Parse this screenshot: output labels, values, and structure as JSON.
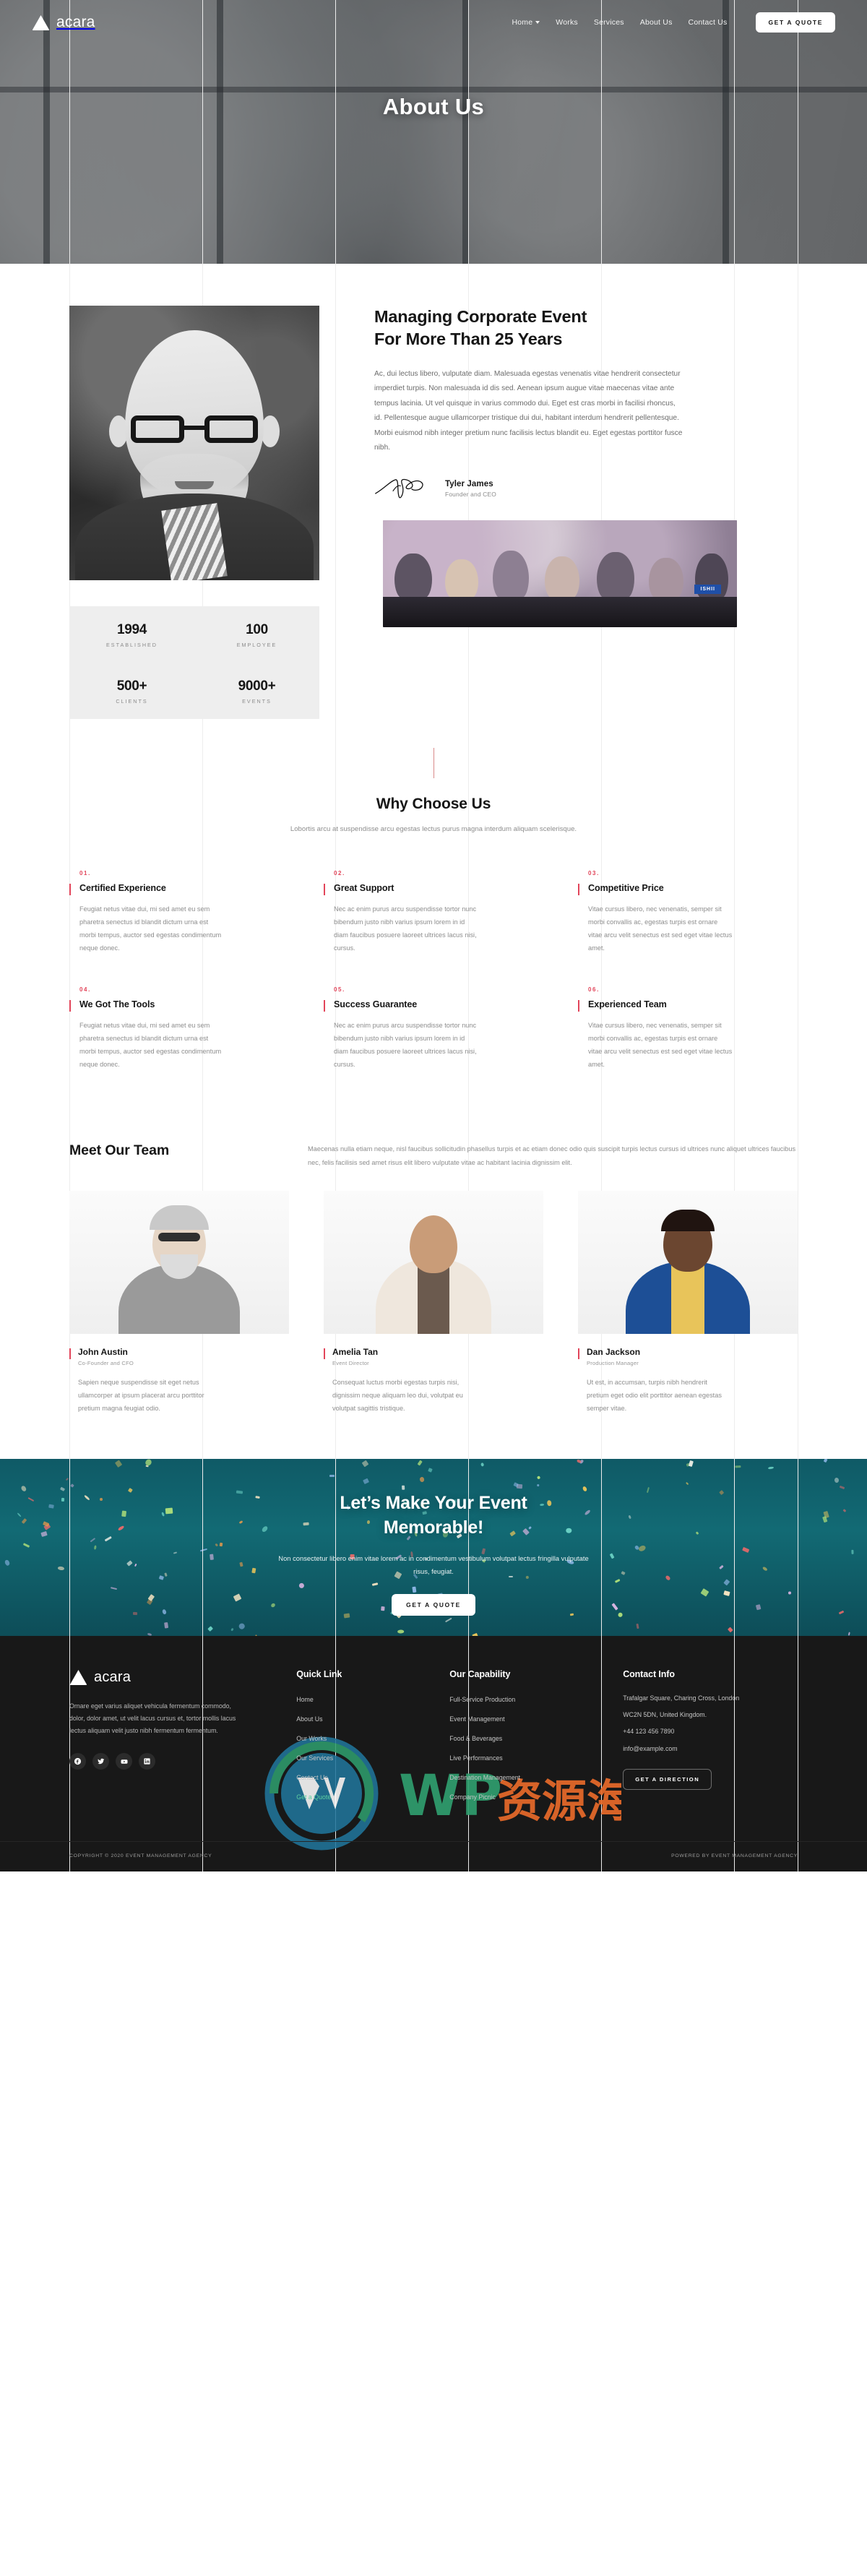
{
  "brand": {
    "name": "acara",
    "logo_icon": "triangle-logo-icon"
  },
  "nav": {
    "items": [
      {
        "label": "Home",
        "has_dropdown": true
      },
      {
        "label": "Works",
        "has_dropdown": false
      },
      {
        "label": "Services",
        "has_dropdown": false
      },
      {
        "label": "About Us",
        "has_dropdown": false
      },
      {
        "label": "Contact Us",
        "has_dropdown": false
      }
    ],
    "cta_label": "GET A QUOTE"
  },
  "hero": {
    "title": "About Us"
  },
  "about": {
    "heading_line1": "Managing Corporate Event",
    "heading_line2": "For More Than 25 Years",
    "body": "Ac, dui lectus libero, vulputate diam. Malesuada egestas venenatis vitae hendrerit consectetur imperdiet turpis. Non malesuada id dis sed. Aenean ipsum augue vitae maecenas vitae ante tempus lacinia. Ut vel quisque in varius commodo dui. Eget est cras morbi in facilisi rhoncus, id. Pellentesque augue ullamcorper tristique dui dui, habitant interdum hendrerit pellentesque. Morbi euismod nibh integer pretium nunc facilisis lectus blandit eu. Eget egestas porttitor fusce nibh.",
    "signature_icon": "signature-icon",
    "person_name": "Tyler James",
    "person_role": "Founder and CEO",
    "meeting_badge": "ISHII"
  },
  "stats": [
    {
      "value": "1994",
      "label": "ESTABLISHED"
    },
    {
      "value": "100",
      "label": "EMPLOYEE"
    },
    {
      "value": "500+",
      "label": "CLIENTS"
    },
    {
      "value": "9000+",
      "label": "EVENTS"
    }
  ],
  "why": {
    "title": "Why Choose Us",
    "subtitle": "Lobortis arcu at suspendisse arcu egestas lectus purus magna interdum aliquam scelerisque.",
    "features": [
      {
        "num": "01.",
        "title": "Certified Experience",
        "body": "Feugiat netus vitae dui, mi sed amet eu sem pharetra senectus id blandit dictum urna est morbi tempus, auctor sed egestas condimentum neque donec."
      },
      {
        "num": "02.",
        "title": "Great Support",
        "body": "Nec ac enim purus arcu suspendisse tortor nunc bibendum justo nibh varius ipsum lorem in id diam faucibus posuere laoreet ultrices lacus nisi, cursus."
      },
      {
        "num": "03.",
        "title": "Competitive Price",
        "body": "Vitae cursus libero, nec venenatis, semper sit morbi convallis ac, egestas turpis est ornare vitae arcu velit senectus est sed eget vitae lectus amet."
      },
      {
        "num": "04.",
        "title": "We Got The Tools",
        "body": "Feugiat netus vitae dui, mi sed amet eu sem pharetra senectus id blandit dictum urna est morbi tempus, auctor sed egestas condimentum neque donec."
      },
      {
        "num": "05.",
        "title": "Success Guarantee",
        "body": "Nec ac enim purus arcu suspendisse tortor nunc bibendum justo nibh varius ipsum lorem in id diam faucibus posuere laoreet ultrices lacus nisi, cursus."
      },
      {
        "num": "06.",
        "title": "Experienced Team",
        "body": "Vitae cursus libero, nec venenatis, semper sit morbi convallis ac, egestas turpis est ornare vitae arcu velit senectus est sed eget vitae lectus amet."
      }
    ]
  },
  "team": {
    "title": "Meet Our Team",
    "intro": "Maecenas nulla etiam neque, nisl faucibus sollicitudin phasellus turpis et ac etiam donec odio quis suscipit turpis lectus cursus id ultrices nunc aliquet ultrices faucibus nec, felis facilisis sed amet risus elit libero vulputate vitae ac habitant lacinia dignissim elit.",
    "members": [
      {
        "name": "John Austin",
        "role": "Co-Founder and  CFO",
        "body": "Sapien neque suspendisse sit eget netus ullamcorper at ipsum placerat arcu porttitor pretium magna feugiat odio."
      },
      {
        "name": "Amelia Tan",
        "role": "Event Director",
        "body": "Consequat luctus morbi egestas turpis nisi, dignissim neque aliquam leo dui, volutpat eu volutpat sagittis tristique."
      },
      {
        "name": "Dan Jackson",
        "role": "Production Manager",
        "body": "Ut est, in accumsan, turpis nibh hendrerit pretium eget odio elit porttitor aenean egestas semper vitae."
      }
    ]
  },
  "cta": {
    "heading_line1": "Let’s Make Your Event",
    "heading_line2": "Memorable!",
    "body": "Non consectetur libero enim vitae lorem ac in condimentum vestibulum volutpat lectus fringilla vulputate risus, feugiat.",
    "button_label": "GET A QUOTE"
  },
  "footer": {
    "about": "Ornare eget varius aliquet vehicula fermentum commodo, dolor, dolor amet, ut velit lacus cursus et, tortor mollis lacus lectus aliquam velit justo nibh fermentum fermentum.",
    "socials": [
      {
        "name": "facebook-icon"
      },
      {
        "name": "twitter-icon"
      },
      {
        "name": "youtube-icon"
      },
      {
        "name": "linkedin-icon"
      }
    ],
    "quick_link": {
      "title": "Quick Link",
      "items": [
        "Home",
        "About Us",
        "Our Works",
        "Our Services",
        "Contact Us",
        "Get a Quote"
      ],
      "highlight_index": 5
    },
    "capability": {
      "title": "Our Capability",
      "items": [
        "Full-Service Production",
        "Event Management",
        "Food & Beverages",
        "Live Performances",
        "Destination Management",
        "Company Picnic"
      ]
    },
    "contact": {
      "title": "Contact Info",
      "address_line1": "Trafalgar Square, Charing Cross, London",
      "address_line2": "WC2N 5DN, United Kingdom.",
      "phone": "+44 123 456 7890",
      "email": "info@example.com",
      "button_label": "GET A DIRECTION"
    },
    "copyright": "COPYRIGHT © 2020 EVENT MANAGEMENT AGENCY",
    "powered": "POWERED BY EVENT MANAGEMENT AGENCY"
  },
  "colors": {
    "accent_red": "#e2455a",
    "cta_teal": "#126a74",
    "footer_bg": "#181818",
    "highlight_green": "#5ecfa0"
  }
}
